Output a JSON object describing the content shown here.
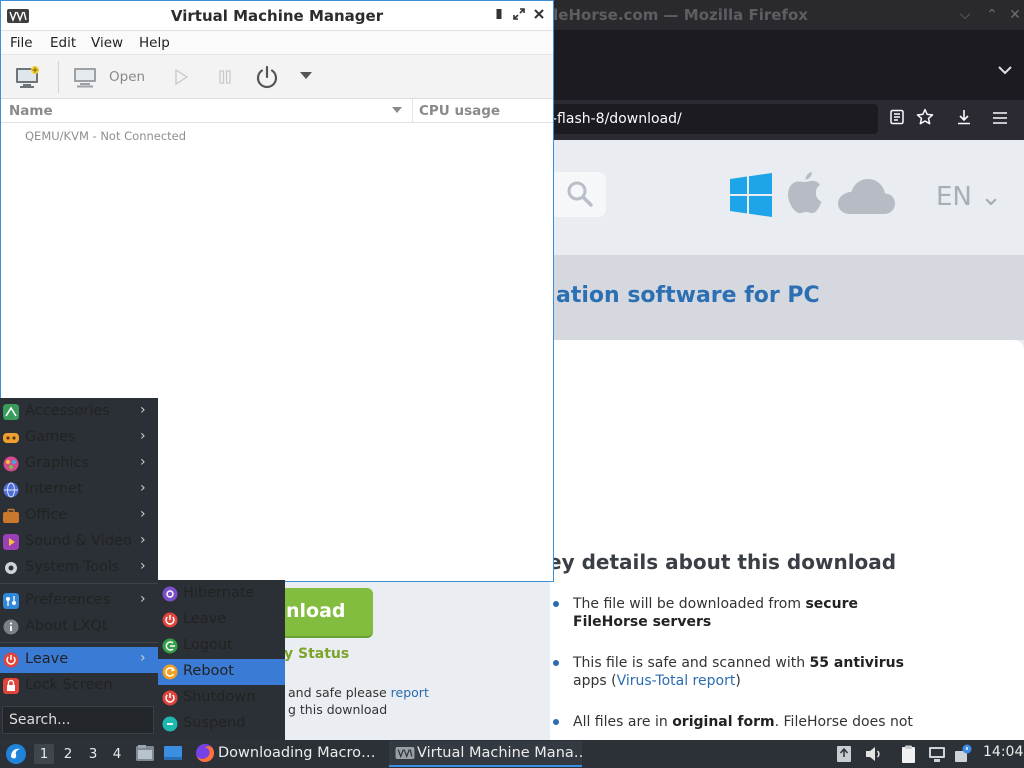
{
  "firefox": {
    "title": "ileHorse.com — Mozilla Firefox",
    "url": "-flash-8/download/",
    "window_buttons": {
      "minimize": "⌵",
      "restore": "⌃",
      "close": "✕"
    },
    "site": {
      "lang": "EN ⌄",
      "hero_text": "ation software for PC",
      "download_button": "nload",
      "verify_status": "y Status",
      "safe_line1_prefix": "and safe please ",
      "safe_line1_link": "report",
      "safe_line2": "g this download",
      "key_details_title": "ey details about this download",
      "key_details": [
        {
          "pre": "The file will be downloaded from ",
          "bold": "secure FileHorse servers",
          "post": "",
          "link": "",
          "tail": ""
        },
        {
          "pre": "This file is safe and scanned with ",
          "bold": "55 antivirus",
          "post": " apps (",
          "link": "Virus-Total report",
          "tail": ")"
        },
        {
          "pre": "All files are in ",
          "bold": "original form",
          "post": ". FileHorse does not",
          "link": "",
          "tail": ""
        }
      ]
    }
  },
  "vmm": {
    "title": "Virtual Machine Manager",
    "menu": [
      "File",
      "Edit",
      "View",
      "Help"
    ],
    "toolbar": {
      "open_label": "Open"
    },
    "columns": {
      "name": "Name",
      "cpu": "CPU usage"
    },
    "connections": [
      "QEMU/KVM - Not Connected"
    ]
  },
  "start_menu": {
    "categories": [
      {
        "label": "Accessories",
        "icon": "accessories-icon",
        "color": "#3a9c5a"
      },
      {
        "label": "Games",
        "icon": "games-icon",
        "color": "#f0a030"
      },
      {
        "label": "Graphics",
        "icon": "graphics-icon",
        "color": "#d54a8a"
      },
      {
        "label": "Internet",
        "icon": "internet-icon",
        "color": "#4f6fd6"
      },
      {
        "label": "Office",
        "icon": "office-icon",
        "color": "#c9782c"
      },
      {
        "label": "Sound & Video",
        "icon": "sound-video-icon",
        "color": "#9b3fb8"
      },
      {
        "label": "System Tools",
        "icon": "system-tools-icon",
        "color": "#cfd3d8"
      }
    ],
    "settings": [
      {
        "label": "Preferences",
        "icon": "preferences-icon",
        "color": "#2f88d8"
      },
      {
        "label": "About LXQt",
        "icon": "info-icon",
        "color": "#7b7f86"
      }
    ],
    "leave": {
      "label": "Leave",
      "icon": "power-icon",
      "color": "#e0443a"
    },
    "lock": {
      "label": "Lock Screen",
      "icon": "lock-icon",
      "color": "#e0443a"
    },
    "search_placeholder": "Search...",
    "leave_submenu": [
      {
        "label": "Hibernate",
        "icon": "hibernate-icon",
        "color": "#7a4fc9"
      },
      {
        "label": "Leave",
        "icon": "power-icon",
        "color": "#e0443a"
      },
      {
        "label": "Logout",
        "icon": "logout-icon",
        "color": "#35a04a"
      },
      {
        "label": "Reboot",
        "icon": "reboot-icon",
        "color": "#f0a020"
      },
      {
        "label": "Shutdown",
        "icon": "shutdown-icon",
        "color": "#e0443a"
      },
      {
        "label": "Suspend",
        "icon": "suspend-icon",
        "color": "#1fb8b0"
      }
    ]
  },
  "taskbar": {
    "desktops": [
      "1",
      "2",
      "3",
      "4"
    ],
    "tasks": [
      {
        "label": "Downloading Macro…",
        "icon": "firefox-icon"
      },
      {
        "label": "Virtual Machine Mana…",
        "icon": "vmm-icon"
      }
    ],
    "clock": "14:04"
  }
}
